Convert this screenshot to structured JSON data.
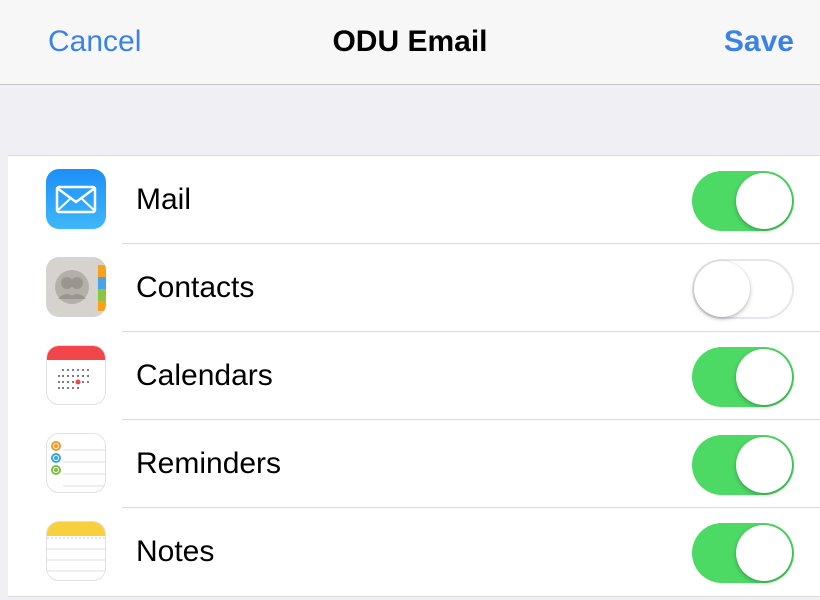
{
  "navbar": {
    "cancel_label": "Cancel",
    "title": "ODU Email",
    "save_label": "Save"
  },
  "colors": {
    "accent": "#3b82e6",
    "toggle_on": "#4cd964",
    "background": "#efeff4"
  },
  "items": [
    {
      "label": "Mail",
      "icon": "mail-icon",
      "enabled": true
    },
    {
      "label": "Contacts",
      "icon": "contacts-icon",
      "enabled": false
    },
    {
      "label": "Calendars",
      "icon": "calendar-icon",
      "enabled": true
    },
    {
      "label": "Reminders",
      "icon": "reminders-icon",
      "enabled": true
    },
    {
      "label": "Notes",
      "icon": "notes-icon",
      "enabled": true
    }
  ]
}
